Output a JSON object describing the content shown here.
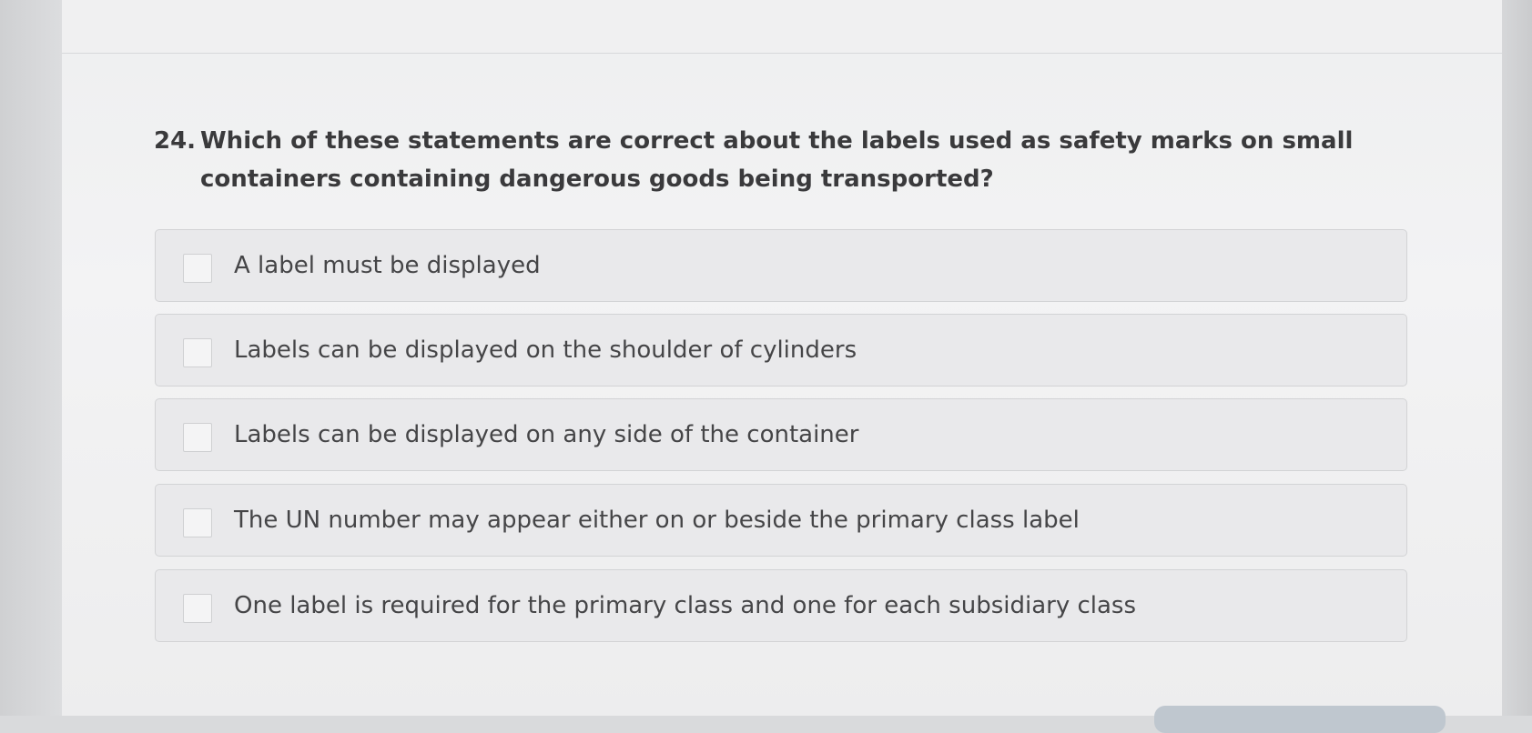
{
  "question": {
    "number": "24.",
    "text": "Which of these statements are correct about the labels used as safety marks on small containers containing dangerous goods being transported?"
  },
  "options": [
    {
      "label": "A label must be displayed",
      "checked": false
    },
    {
      "label": "Labels can be displayed on the shoulder of cylinders",
      "checked": false
    },
    {
      "label": "Labels can be displayed on any side of the container",
      "checked": false
    },
    {
      "label": "The UN number may appear either on or beside the primary class label",
      "checked": false
    },
    {
      "label": "One label is required for the primary class and one for each subsidiary class",
      "checked": false
    }
  ]
}
